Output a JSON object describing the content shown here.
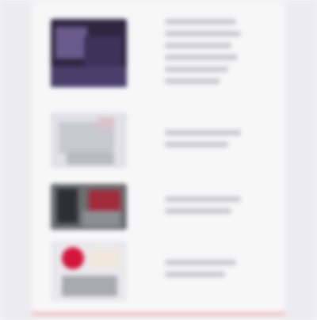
{
  "feed": {
    "items": [
      {
        "thumbnail": {
          "palette": [
            "#3c325a",
            "#6b5b8d",
            "#2e2740"
          ]
        },
        "text_lines": 6
      },
      {
        "thumbnail": {
          "palette": [
            "#c8c8d0",
            "#e1e1e6",
            "#b9b9c2"
          ]
        },
        "text_lines": 2
      },
      {
        "thumbnail": {
          "palette": [
            "#6c6d70",
            "#a12b3b",
            "#2d2f33"
          ]
        },
        "text_lines": 2
      },
      {
        "thumbnail": {
          "palette": [
            "#e9e9ec",
            "#d4163a",
            "#a9a9b1"
          ]
        },
        "text_lines": 2
      }
    ]
  },
  "colors": {
    "background": "#f2f2f3",
    "panel": "#f7f7f8",
    "text_placeholder": "#c9c9cc",
    "accent": "#efc1c6"
  }
}
